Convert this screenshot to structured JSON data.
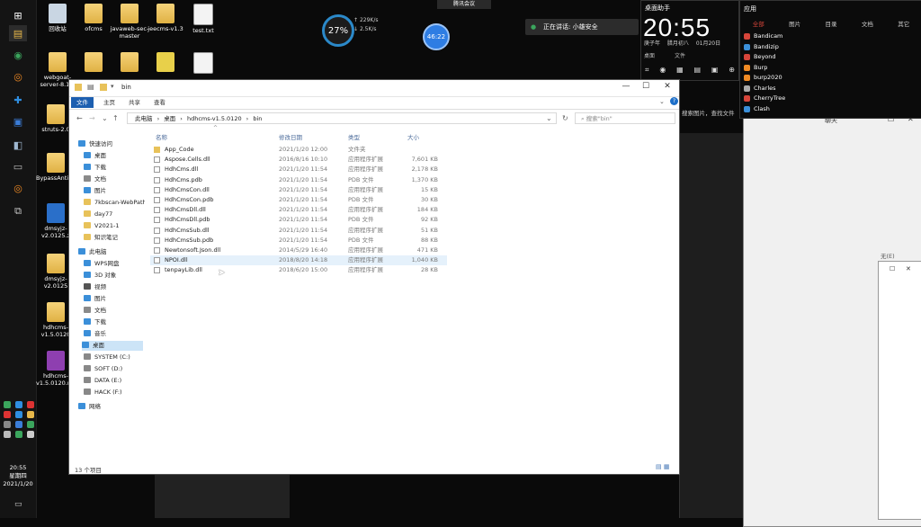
{
  "taskbar": {
    "time": "20:55",
    "weekday": "星期四",
    "date": "2021/1/20"
  },
  "desktop_icons": [
    "回收站",
    "ofcms",
    "javaweb-sec-master",
    "jeecms-v1.3",
    "test.txt",
    "webgoat-server-8.1.0",
    "struts-2.0",
    "BypassAntivirus",
    "dmsyjz-v2.0125.z",
    "dmsyjz-v2.0125",
    "hdhcms-v1.5.0120",
    "hdhcms-v1.5.0120.rar"
  ],
  "widgets": {
    "gauge": "27%",
    "net_up": "229K/s",
    "net_down": "2.5K/s",
    "blue_circle": "46:22",
    "meeting": "腾讯会议",
    "mic_text": "正在讲话: 小雄安全"
  },
  "clock": {
    "title": "桌面助手",
    "time": "20:55",
    "lunar": "庚子年 腊月初八",
    "date": "01月20日",
    "row2": [
      "桌面",
      "文件"
    ]
  },
  "apps": {
    "title": "应用",
    "tabs": [
      "全部",
      "图片",
      "目录",
      "文档",
      "其它"
    ],
    "items": [
      "Bandicam",
      "Bandizip",
      "Beyond",
      "Burp",
      "burp2020",
      "Charles",
      "CherryTree",
      "Clash"
    ],
    "search_hint": "搜索图片，查找文件"
  },
  "explorer": {
    "title": "bin",
    "ribbon": [
      "文件",
      "主页",
      "共享",
      "查看"
    ],
    "breadcrumb": [
      "此电脑",
      "桌面",
      "hdhcms-v1.5.0120",
      "bin"
    ],
    "search_placeholder": "搜索\"bin\"",
    "nav": [
      {
        "label": "快速访问",
        "color": "#3b8fd9"
      },
      {
        "label": "桌面",
        "color": "#3b8fd9"
      },
      {
        "label": "下载",
        "color": "#3b8fd9"
      },
      {
        "label": "文档",
        "color": "#8a8a8a"
      },
      {
        "label": "图片",
        "color": "#3b8fd9"
      },
      {
        "label": "7kbscan-WebPath",
        "color": "#e8c25a"
      },
      {
        "label": "day77",
        "color": "#e8c25a"
      },
      {
        "label": "V2021-1",
        "color": "#e8c25a"
      },
      {
        "label": "知识笔记",
        "color": "#e8c25a"
      },
      {
        "label": "此电脑",
        "color": "#3b8fd9"
      },
      {
        "label": "WPS网盘",
        "color": "#3b8fd9"
      },
      {
        "label": "3D 对象",
        "color": "#3b8fd9"
      },
      {
        "label": "视频",
        "color": "#555"
      },
      {
        "label": "图片",
        "color": "#3b8fd9"
      },
      {
        "label": "文档",
        "color": "#8a8a8a"
      },
      {
        "label": "下载",
        "color": "#3b8fd9"
      },
      {
        "label": "音乐",
        "color": "#3b8fd9"
      },
      {
        "label": "桌面",
        "color": "#3b8fd9"
      },
      {
        "label": "SYSTEM (C:)",
        "color": "#888"
      },
      {
        "label": "SOFT (D:)",
        "color": "#888"
      },
      {
        "label": "DATA (E:)",
        "color": "#888"
      },
      {
        "label": "HACK (F:)",
        "color": "#888"
      },
      {
        "label": "网络",
        "color": "#3b8fd9"
      }
    ],
    "columns": [
      "名称",
      "修改日期",
      "类型",
      "大小"
    ],
    "files": [
      {
        "name": "App_Code",
        "date": "2021/1/20 12:00",
        "type": "文件夹",
        "size": "",
        "kind": "folder"
      },
      {
        "name": "Aspose.Cells.dll",
        "date": "2016/8/16 10:10",
        "type": "应用程序扩展",
        "size": "7,601 KB",
        "kind": "dll"
      },
      {
        "name": "HdhCms.dll",
        "date": "2021/1/20 11:54",
        "type": "应用程序扩展",
        "size": "2,178 KB",
        "kind": "dll"
      },
      {
        "name": "HdhCms.pdb",
        "date": "2021/1/20 11:54",
        "type": "PDB 文件",
        "size": "1,370 KB",
        "kind": "pdb"
      },
      {
        "name": "HdhCmsCon.dll",
        "date": "2021/1/20 11:54",
        "type": "应用程序扩展",
        "size": "15 KB",
        "kind": "dll"
      },
      {
        "name": "HdhCmsCon.pdb",
        "date": "2021/1/20 11:54",
        "type": "PDB 文件",
        "size": "30 KB",
        "kind": "pdb"
      },
      {
        "name": "HdhCmsDll.dll",
        "date": "2021/1/20 11:54",
        "type": "应用程序扩展",
        "size": "184 KB",
        "kind": "dll"
      },
      {
        "name": "HdhCmsDll.pdb",
        "date": "2021/1/20 11:54",
        "type": "PDB 文件",
        "size": "92 KB",
        "kind": "pdb"
      },
      {
        "name": "HdhCmsSub.dll",
        "date": "2021/1/20 11:54",
        "type": "应用程序扩展",
        "size": "51 KB",
        "kind": "dll"
      },
      {
        "name": "HdhCmsSub.pdb",
        "date": "2021/1/20 11:54",
        "type": "PDB 文件",
        "size": "88 KB",
        "kind": "pdb"
      },
      {
        "name": "Newtonsoft.Json.dll",
        "date": "2014/5/29 16:40",
        "type": "应用程序扩展",
        "size": "471 KB",
        "kind": "dll"
      },
      {
        "name": "NPOI.dll",
        "date": "2018/8/20 14:18",
        "type": "应用程序扩展",
        "size": "1,040 KB",
        "kind": "dll"
      },
      {
        "name": "tenpayLib.dll",
        "date": "2018/6/20 15:00",
        "type": "应用程序扩展",
        "size": "28 KB",
        "kind": "dll"
      }
    ],
    "status": "13 个项目"
  },
  "right_window": {
    "title": "聊天",
    "label": "无(E)"
  }
}
